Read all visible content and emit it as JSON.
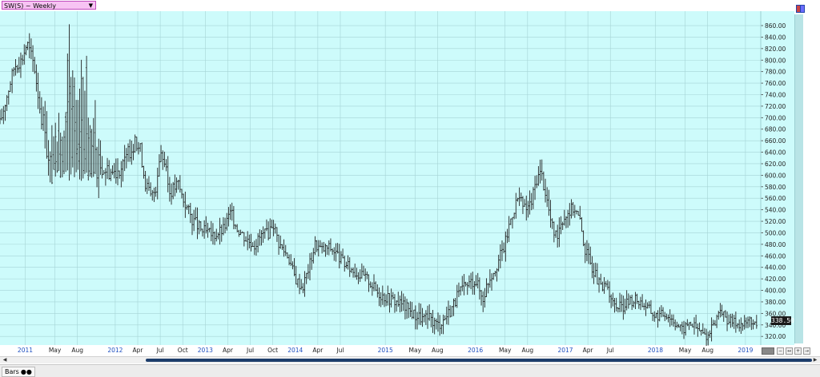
{
  "window": {
    "title_label": "SW(S) ~ Weekly",
    "bottom_tab_label": "Bars",
    "last_price_label": "338.50"
  },
  "colors": {
    "plot_background": "#cdfbfb",
    "grid": "#a6d4d6",
    "bars": "#222222",
    "axis_text": "#222222",
    "year_text": "#1e4fc0",
    "title_tab_bg": "#f7c3f3"
  },
  "chart_data": {
    "type": "bar",
    "subtype": "ohlc",
    "interval": "weekly",
    "series_name": "SW(S)",
    "ylim": [
      305,
      885
    ],
    "y_ticks": [
      "320.00",
      "340.00",
      "360.00",
      "380.00",
      "400.00",
      "420.00",
      "440.00",
      "460.00",
      "480.00",
      "500.00",
      "520.00",
      "540.00",
      "560.00",
      "580.00",
      "600.00",
      "620.00",
      "640.00",
      "660.00",
      "680.00",
      "700.00",
      "720.00",
      "740.00",
      "760.00",
      "780.00",
      "800.00",
      "820.00",
      "840.00",
      "860.00"
    ],
    "x_range": [
      2010.72,
      2019.17
    ],
    "x_ticks": [
      {
        "label": "2011",
        "x": 2011.0,
        "year": true
      },
      {
        "label": "May",
        "x": 2011.33,
        "year": false
      },
      {
        "label": "Aug",
        "x": 2011.58,
        "year": false
      },
      {
        "label": "2012",
        "x": 2012.0,
        "year": true
      },
      {
        "label": "Apr",
        "x": 2012.25,
        "year": false
      },
      {
        "label": "Jul",
        "x": 2012.5,
        "year": false
      },
      {
        "label": "Oct",
        "x": 2012.75,
        "year": false
      },
      {
        "label": "2013",
        "x": 2013.0,
        "year": true
      },
      {
        "label": "Apr",
        "x": 2013.25,
        "year": false
      },
      {
        "label": "Jul",
        "x": 2013.5,
        "year": false
      },
      {
        "label": "Oct",
        "x": 2013.75,
        "year": false
      },
      {
        "label": "2014",
        "x": 2014.0,
        "year": true
      },
      {
        "label": "Apr",
        "x": 2014.25,
        "year": false
      },
      {
        "label": "Jul",
        "x": 2014.5,
        "year": false
      },
      {
        "label": "2015",
        "x": 2015.0,
        "year": true
      },
      {
        "label": "May",
        "x": 2015.33,
        "year": false
      },
      {
        "label": "Aug",
        "x": 2015.58,
        "year": false
      },
      {
        "label": "2016",
        "x": 2016.0,
        "year": true
      },
      {
        "label": "May",
        "x": 2016.33,
        "year": false
      },
      {
        "label": "Aug",
        "x": 2016.58,
        "year": false
      },
      {
        "label": "2017",
        "x": 2017.0,
        "year": true
      },
      {
        "label": "Apr",
        "x": 2017.25,
        "year": false
      },
      {
        "label": "Jul",
        "x": 2017.5,
        "year": false
      },
      {
        "label": "2018",
        "x": 2018.0,
        "year": true
      },
      {
        "label": "May",
        "x": 2018.33,
        "year": false
      },
      {
        "label": "Aug",
        "x": 2018.58,
        "year": false
      },
      {
        "label": "2019",
        "x": 2019.0,
        "year": true
      }
    ],
    "last_value": 338.5,
    "grid": true,
    "price_path": [
      [
        2010.72,
        690
      ],
      [
        2010.8,
        740
      ],
      [
        2010.88,
        790
      ],
      [
        2010.96,
        800
      ],
      [
        2011.02,
        830
      ],
      [
        2011.1,
        790
      ],
      [
        2011.18,
        700
      ],
      [
        2011.22,
        690
      ],
      [
        2011.25,
        620
      ],
      [
        2011.3,
        610
      ],
      [
        2011.35,
        610
      ],
      [
        2011.4,
        620
      ],
      [
        2011.48,
        650
      ],
      [
        2011.55,
        690
      ],
      [
        2011.62,
        690
      ],
      [
        2011.7,
        650
      ],
      [
        2011.8,
        620
      ],
      [
        2011.9,
        610
      ],
      [
        2011.98,
        605
      ],
      [
        2012.08,
        615
      ],
      [
        2012.15,
        640
      ],
      [
        2012.22,
        655
      ],
      [
        2012.28,
        645
      ],
      [
        2012.33,
        590
      ],
      [
        2012.4,
        560
      ],
      [
        2012.45,
        580
      ],
      [
        2012.5,
        645
      ],
      [
        2012.55,
        620
      ],
      [
        2012.6,
        570
      ],
      [
        2012.7,
        585
      ],
      [
        2012.75,
        560
      ],
      [
        2012.85,
        525
      ],
      [
        2012.95,
        505
      ],
      [
        2013.08,
        495
      ],
      [
        2013.2,
        505
      ],
      [
        2013.28,
        535
      ],
      [
        2013.35,
        510
      ],
      [
        2013.45,
        490
      ],
      [
        2013.55,
        480
      ],
      [
        2013.62,
        495
      ],
      [
        2013.7,
        500
      ],
      [
        2013.75,
        520
      ],
      [
        2013.82,
        480
      ],
      [
        2013.92,
        460
      ],
      [
        2014.0,
        420
      ],
      [
        2014.08,
        405
      ],
      [
        2014.15,
        440
      ],
      [
        2014.22,
        480
      ],
      [
        2014.3,
        470
      ],
      [
        2014.38,
        475
      ],
      [
        2014.45,
        465
      ],
      [
        2014.55,
        445
      ],
      [
        2014.68,
        430
      ],
      [
        2014.8,
        420
      ],
      [
        2014.92,
        395
      ],
      [
        2015.05,
        385
      ],
      [
        2015.2,
        375
      ],
      [
        2015.3,
        360
      ],
      [
        2015.42,
        350
      ],
      [
        2015.5,
        350
      ],
      [
        2015.58,
        340
      ],
      [
        2015.65,
        350
      ],
      [
        2015.72,
        365
      ],
      [
        2015.82,
        395
      ],
      [
        2015.92,
        410
      ],
      [
        2016.0,
        420
      ],
      [
        2016.08,
        385
      ],
      [
        2016.15,
        420
      ],
      [
        2016.25,
        450
      ],
      [
        2016.33,
        480
      ],
      [
        2016.4,
        530
      ],
      [
        2016.47,
        560
      ],
      [
        2016.55,
        540
      ],
      [
        2016.62,
        550
      ],
      [
        2016.68,
        595
      ],
      [
        2016.73,
        605
      ],
      [
        2016.78,
        570
      ],
      [
        2016.85,
        510
      ],
      [
        2016.9,
        495
      ],
      [
        2016.95,
        520
      ],
      [
        2017.02,
        535
      ],
      [
        2017.1,
        545
      ],
      [
        2017.16,
        520
      ],
      [
        2017.22,
        470
      ],
      [
        2017.3,
        440
      ],
      [
        2017.4,
        400
      ],
      [
        2017.47,
        410
      ],
      [
        2017.53,
        375
      ],
      [
        2017.62,
        370
      ],
      [
        2017.7,
        380
      ],
      [
        2017.78,
        385
      ],
      [
        2017.88,
        375
      ],
      [
        2018.0,
        355
      ],
      [
        2018.12,
        360
      ],
      [
        2018.22,
        345
      ],
      [
        2018.3,
        330
      ],
      [
        2018.38,
        345
      ],
      [
        2018.45,
        335
      ],
      [
        2018.53,
        325
      ],
      [
        2018.58,
        320
      ],
      [
        2018.65,
        340
      ],
      [
        2018.72,
        370
      ],
      [
        2018.78,
        350
      ],
      [
        2018.88,
        345
      ],
      [
        2018.98,
        340
      ],
      [
        2019.05,
        350
      ],
      [
        2019.1,
        342
      ],
      [
        2019.14,
        338.5
      ]
    ],
    "weekly_range_envelope": [
      [
        2010.72,
        25
      ],
      [
        2011.18,
        30
      ],
      [
        2011.3,
        80
      ],
      [
        2011.58,
        160
      ],
      [
        2011.75,
        100
      ],
      [
        2011.85,
        35
      ],
      [
        2012.5,
        28
      ],
      [
        2014.5,
        22
      ],
      [
        2016.7,
        30
      ],
      [
        2017.2,
        25
      ],
      [
        2019.14,
        18
      ]
    ],
    "volatile_spike_zone": {
      "from": 2011.3,
      "to": 2011.78,
      "low": 590,
      "high": 880
    }
  }
}
